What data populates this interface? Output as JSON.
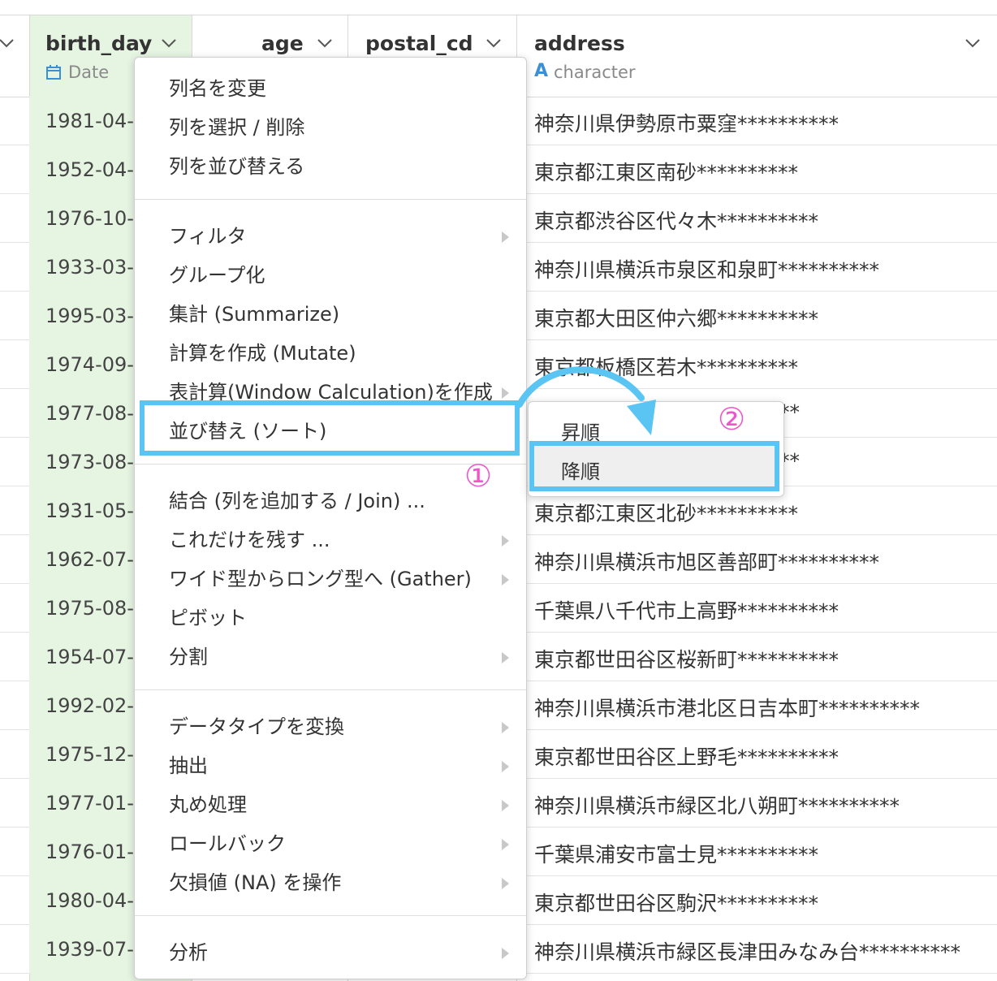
{
  "columns": {
    "birth_day": {
      "name": "birth_day",
      "type": "Date"
    },
    "age": {
      "name": "age"
    },
    "postal_cd": {
      "name": "postal_cd"
    },
    "address": {
      "name": "address",
      "type": "character",
      "type_icon": "A"
    }
  },
  "rows": [
    {
      "birth_day": "1981-04-",
      "address": "神奈川県伊勢原市粟窪**********"
    },
    {
      "birth_day": "1952-04-",
      "address": "東京都江東区南砂**********"
    },
    {
      "birth_day": "1976-10-",
      "address": "東京都渋谷区代々木**********"
    },
    {
      "birth_day": "1933-03-",
      "address": "神奈川県横浜市泉区和泉町**********"
    },
    {
      "birth_day": "1995-03-",
      "address": "東京都大田区仲六郷**********"
    },
    {
      "birth_day": "1974-09-",
      "address": "東京都板橋区若木**********"
    },
    {
      "birth_day": "1977-08-",
      "address": "**"
    },
    {
      "birth_day": "1973-08-",
      "address": "**"
    },
    {
      "birth_day": "1931-05-",
      "address": "東京都江東区北砂**********"
    },
    {
      "birth_day": "1962-07-",
      "address": "神奈川県横浜市旭区善部町**********"
    },
    {
      "birth_day": "1975-08-",
      "address": "千葉県八千代市上高野**********"
    },
    {
      "birth_day": "1954-07-",
      "address": "東京都世田谷区桜新町**********"
    },
    {
      "birth_day": "1992-02-",
      "address": "神奈川県横浜市港北区日吉本町**********"
    },
    {
      "birth_day": "1975-12-",
      "address": "東京都世田谷区上野毛**********"
    },
    {
      "birth_day": "1977-01-",
      "address": "神奈川県横浜市緑区北八朔町**********"
    },
    {
      "birth_day": "1976-01-",
      "address": "千葉県浦安市富士見**********"
    },
    {
      "birth_day": "1980-04-",
      "address": "東京都世田谷区駒沢**********"
    },
    {
      "birth_day": "1939-07-",
      "address": "神奈川県横浜市緑区長津田みなみ台**********"
    }
  ],
  "menu": {
    "items": [
      {
        "label": "列名を変更",
        "submenu": false
      },
      {
        "label": "列を選択 / 削除",
        "submenu": false
      },
      {
        "label": "列を並び替える",
        "submenu": false
      },
      {
        "label": "フィルタ",
        "submenu": true
      },
      {
        "label": "グループ化",
        "submenu": false
      },
      {
        "label": "集計 (Summarize)",
        "submenu": false
      },
      {
        "label": "計算を作成 (Mutate)",
        "submenu": false
      },
      {
        "label": "表計算(Window Calculation)を作成",
        "submenu": true
      },
      {
        "label": "並び替え (ソート)",
        "submenu": false
      },
      {
        "label": "結合 (列を追加する / Join) ...",
        "submenu": false
      },
      {
        "label": "これだけを残す ...",
        "submenu": true
      },
      {
        "label": "ワイド型からロング型へ (Gather)",
        "submenu": true
      },
      {
        "label": "ピボット",
        "submenu": false
      },
      {
        "label": "分割",
        "submenu": true
      },
      {
        "label": "データタイプを変換",
        "submenu": true
      },
      {
        "label": "抽出",
        "submenu": true
      },
      {
        "label": "丸め処理",
        "submenu": true
      },
      {
        "label": "ロールバック",
        "submenu": true
      },
      {
        "label": "欠損値 (NA) を操作",
        "submenu": true
      },
      {
        "label": "分析",
        "submenu": true
      }
    ]
  },
  "sort_submenu": {
    "ascending": "昇順",
    "descending": "降順"
  },
  "annotations": {
    "step1": "①",
    "step2": "②",
    "highlight_color": "#5ac4f2",
    "marker_color": "#ee55cc"
  },
  "colors": {
    "date_column_bg": "#e6f4e2",
    "date_icon": "#3b8fd9",
    "character_icon": "#3b8fd9"
  }
}
